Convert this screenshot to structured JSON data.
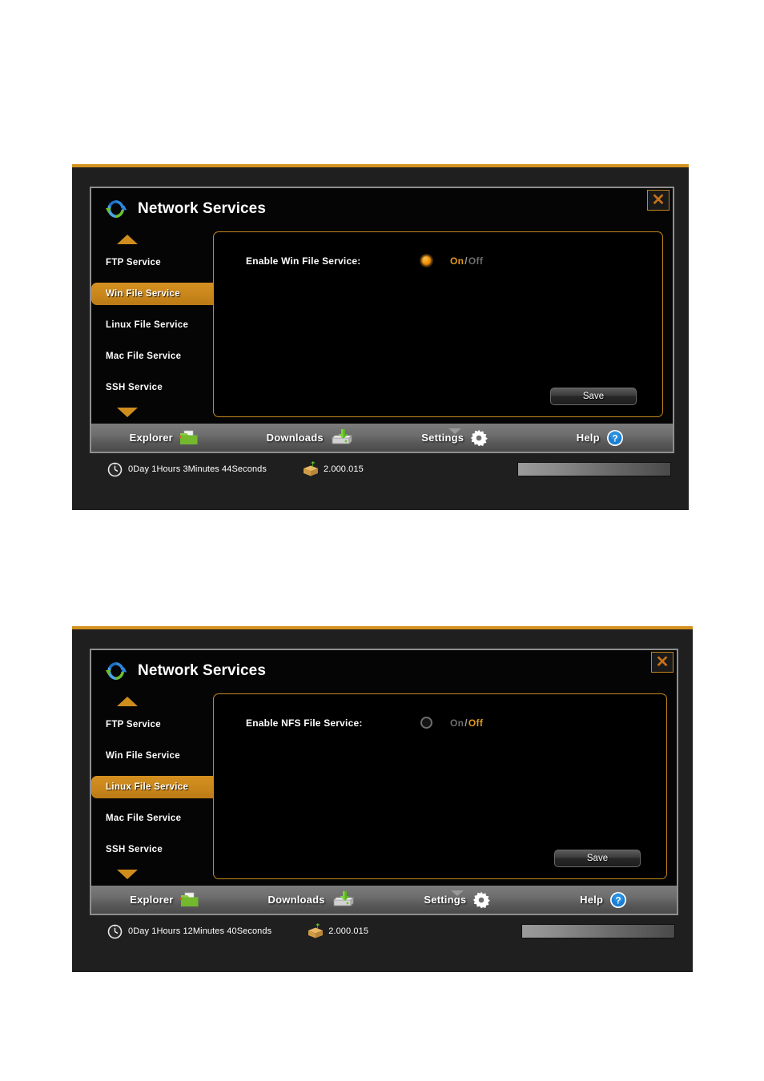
{
  "figures": [
    {
      "id": "fig-win-file-service",
      "title": "Network Services",
      "close_label": "✕",
      "sidebar": {
        "scroll_up": "scroll-up",
        "scroll_down": "scroll-down",
        "items": [
          {
            "label": "FTP Service",
            "active": false
          },
          {
            "label": "Win File Service",
            "active": true
          },
          {
            "label": "Linux File Service",
            "active": false
          },
          {
            "label": "Mac File Service",
            "active": false
          },
          {
            "label": "SSH Service",
            "active": false
          }
        ]
      },
      "content": {
        "field_label": "Enable Win File Service:",
        "toggle_state": "on",
        "on_label": "On",
        "separator": "/",
        "off_label": "Off",
        "save_label": "Save"
      },
      "navbar": [
        {
          "label": "Explorer",
          "icon": "folder-icon",
          "notch": false
        },
        {
          "label": "Downloads",
          "icon": "disk-download-icon",
          "notch": false
        },
        {
          "label": "Settings",
          "icon": "gear-icon",
          "notch": true
        },
        {
          "label": "Help",
          "icon": "question-circle-icon",
          "notch": false
        }
      ],
      "status": {
        "uptime": "0Day 1Hours 3Minutes 44Seconds",
        "version": "2.000.015"
      }
    },
    {
      "id": "fig-linux-file-service",
      "title": "Network Services",
      "close_label": "✕",
      "sidebar": {
        "scroll_up": "scroll-up",
        "scroll_down": "scroll-down",
        "items": [
          {
            "label": "FTP Service",
            "active": false
          },
          {
            "label": "Win File Service",
            "active": false
          },
          {
            "label": "Linux File Service",
            "active": true
          },
          {
            "label": "Mac File Service",
            "active": false
          },
          {
            "label": "SSH Service",
            "active": false
          }
        ]
      },
      "content": {
        "field_label": "Enable NFS File Service:",
        "toggle_state": "off",
        "on_label": "On",
        "separator": "/",
        "off_label": "Off",
        "save_label": "Save"
      },
      "navbar": [
        {
          "label": "Explorer",
          "icon": "folder-icon",
          "notch": false
        },
        {
          "label": "Downloads",
          "icon": "disk-download-icon",
          "notch": false
        },
        {
          "label": "Settings",
          "icon": "gear-icon",
          "notch": true
        },
        {
          "label": "Help",
          "icon": "question-circle-icon",
          "notch": false
        }
      ],
      "status": {
        "uptime": "0Day 1Hours 12Minutes 40Seconds",
        "version": "2.000.015"
      }
    }
  ],
  "colors": {
    "accent_orange": "#c4881c",
    "active_orange": "#d49020",
    "panel_black": "#000000",
    "window_dark": "#1f1f1f",
    "navbar_grey": "#6e6e6e",
    "text_white": "#ffffff",
    "muted_grey": "#6d6d6d"
  }
}
